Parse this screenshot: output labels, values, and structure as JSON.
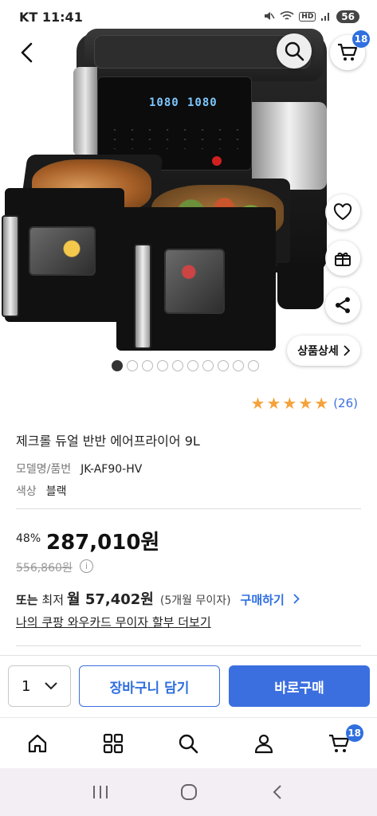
{
  "status_bar": {
    "carrier": "KT",
    "time": "11:41",
    "icons": [
      "mute-icon",
      "wifi-icon",
      "hd-icon",
      "signal-icon"
    ],
    "battery": "56"
  },
  "header": {
    "cart_badge": "18"
  },
  "gallery": {
    "image_count": 10,
    "active_index": 0,
    "detail_button_label": "상품상세"
  },
  "rating": {
    "stars": 5,
    "count_label": "(26)"
  },
  "product": {
    "title": "제크롤 듀얼 반반 에어프라이어 9L",
    "model_label": "모델명/품번",
    "model_value": "JK-AF90-HV",
    "color_label": "색상",
    "color_value": "블랙"
  },
  "pricing": {
    "discount": "48%",
    "price": "287,010원",
    "original_price": "556,860원",
    "install_prefix": "또는",
    "install_min": "최저",
    "install_monthly": "월 57,402원",
    "install_months": "(5개월 무이자)",
    "install_buy_label": "구매하기",
    "card_link": "나의 쿠팡 와우카드 무이자 할부 더보기"
  },
  "action_bar": {
    "quantity": "1",
    "add_to_cart_label": "장바구니 담기",
    "buy_now_label": "바로구매"
  },
  "bottom_nav": {
    "items": [
      "home-icon",
      "categories-icon",
      "search-icon",
      "user-icon",
      "cart-icon"
    ],
    "cart_badge": "18"
  },
  "colors": {
    "accent": "#3b6fe0",
    "star": "#f5a23a",
    "text": "#111111",
    "muted": "#777777"
  }
}
